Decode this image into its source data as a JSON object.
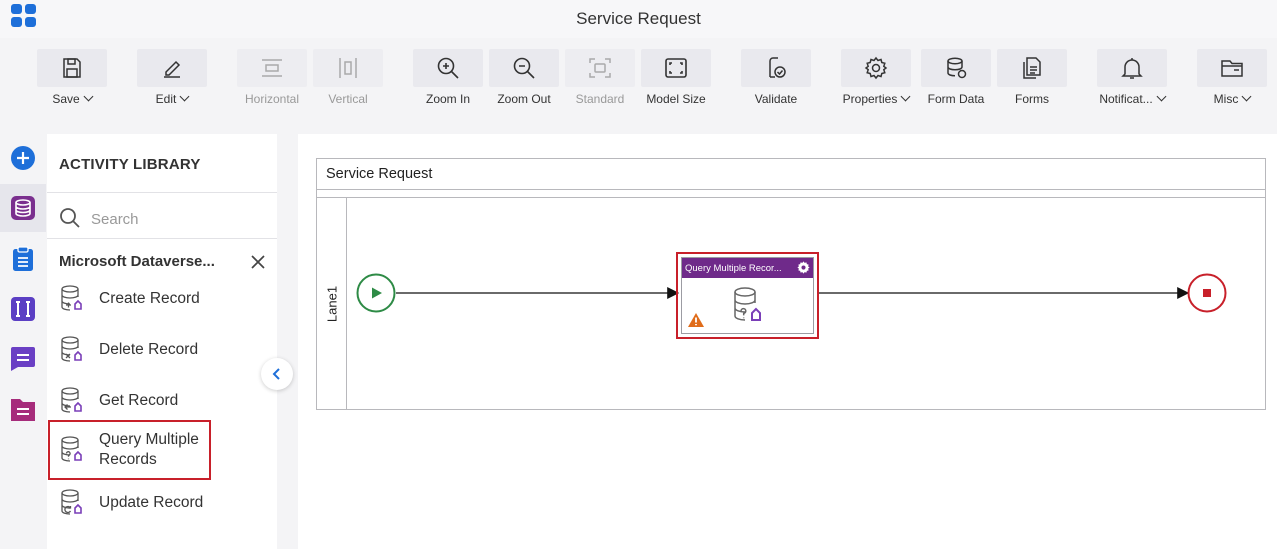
{
  "window": {
    "title": "Service Request"
  },
  "toolbar": {
    "items": [
      {
        "label": "Save",
        "icon": "save-icon",
        "dropdown": true,
        "disabled": false
      },
      {
        "label": "Edit",
        "icon": "pencil-icon",
        "dropdown": true,
        "disabled": false
      },
      {
        "label": "Horizontal",
        "icon": "horizontal-layout-icon",
        "dropdown": false,
        "disabled": true
      },
      {
        "label": "Vertical",
        "icon": "vertical-layout-icon",
        "dropdown": false,
        "disabled": true
      },
      {
        "label": "Zoom In",
        "icon": "zoom-in-icon",
        "dropdown": false,
        "disabled": false
      },
      {
        "label": "Zoom Out",
        "icon": "zoom-out-icon",
        "dropdown": false,
        "disabled": false
      },
      {
        "label": "Standard",
        "icon": "standard-size-icon",
        "dropdown": false,
        "disabled": true
      },
      {
        "label": "Model Size",
        "icon": "model-size-icon",
        "dropdown": false,
        "disabled": false
      },
      {
        "label": "Validate",
        "icon": "validate-icon",
        "dropdown": false,
        "disabled": false
      },
      {
        "label": "Properties",
        "icon": "gear-icon",
        "dropdown": true,
        "disabled": false
      },
      {
        "label": "Form Data",
        "icon": "form-data-icon",
        "dropdown": false,
        "disabled": false
      },
      {
        "label": "Forms",
        "icon": "forms-icon",
        "dropdown": false,
        "disabled": false
      },
      {
        "label": "Notificat...",
        "icon": "bell-icon",
        "dropdown": true,
        "disabled": false
      },
      {
        "label": "Misc",
        "icon": "folder-icon",
        "dropdown": true,
        "disabled": false
      }
    ]
  },
  "rail": {
    "items": [
      {
        "icon": "add-circle-icon",
        "color": "#1e6fd9"
      },
      {
        "icon": "database-icon",
        "color": "#7a2f8e",
        "active": true
      },
      {
        "icon": "clipboard-icon",
        "color": "#1e6fd9"
      },
      {
        "icon": "text-field-icon",
        "color": "#5b3fc4"
      },
      {
        "icon": "chat-icon",
        "color": "#6a3fc4"
      },
      {
        "icon": "document-icon",
        "color": "#a62c7b"
      }
    ]
  },
  "library": {
    "title": "ACTIVITY LIBRARY",
    "search_placeholder": "Search",
    "group": "Microsoft Dataverse...",
    "items": [
      {
        "label": "Create Record",
        "icon": "create-record-icon"
      },
      {
        "label": "Delete Record",
        "icon": "delete-record-icon"
      },
      {
        "label": "Get Record",
        "icon": "get-record-icon"
      },
      {
        "label": "Query Multiple Records",
        "icon": "query-records-icon",
        "selected": true
      },
      {
        "label": "Update Record",
        "icon": "update-record-icon"
      }
    ]
  },
  "canvas": {
    "pool_name": "Service Request",
    "lane_name": "Lane1",
    "task": {
      "title": "Query Multiple Recor...",
      "has_warning": true
    }
  },
  "colors": {
    "accent": "#1e6fd9",
    "task_header": "#6f2a8a",
    "selection": "#c8202a",
    "start_event": "#2e8b46",
    "end_event": "#c8202a",
    "warning": "#e06c1a"
  }
}
